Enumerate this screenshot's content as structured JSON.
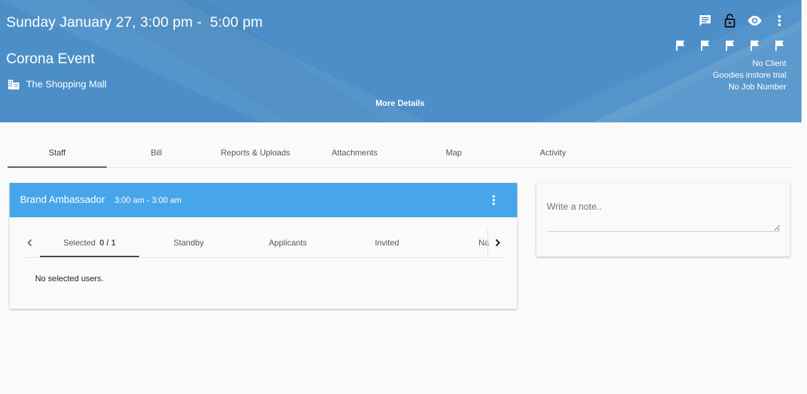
{
  "header": {
    "datetime": "Sunday January 27, 3:00 pm -  5:00 pm",
    "title": "Corona Event",
    "venue": "The Shopping Mall",
    "more_details": "More Details",
    "top_icons": [
      "message-icon",
      "lock-open-icon",
      "eye-icon",
      "more-vert-icon"
    ],
    "flags": [
      "flag-icon",
      "flag-icon",
      "flag-icon",
      "flag-icon",
      "flag-icon"
    ],
    "meta": {
      "client": "No Client",
      "campaign": "Goodies instore trial",
      "job_number": "No Job Number"
    },
    "colors": {
      "banner": "#4c8fc8",
      "text": "#ffffff"
    }
  },
  "tabs": [
    {
      "label": "Staff",
      "active": true
    },
    {
      "label": "Bill"
    },
    {
      "label": "Reports & Uploads"
    },
    {
      "label": "Attachments"
    },
    {
      "label": "Map"
    },
    {
      "label": "Activity"
    }
  ],
  "staff_card": {
    "role": "Brand Ambassador",
    "time": "3:00 am - 3:00 am",
    "header_color": "#47a6ea",
    "subtabs": [
      {
        "label": "Selected",
        "count": "0 / 1",
        "active": true
      },
      {
        "label": "Standby"
      },
      {
        "label": "Applicants"
      },
      {
        "label": "Invited"
      },
      {
        "label": "Na"
      }
    ],
    "empty_message": "No selected users."
  },
  "note": {
    "placeholder": "Write a note.."
  }
}
